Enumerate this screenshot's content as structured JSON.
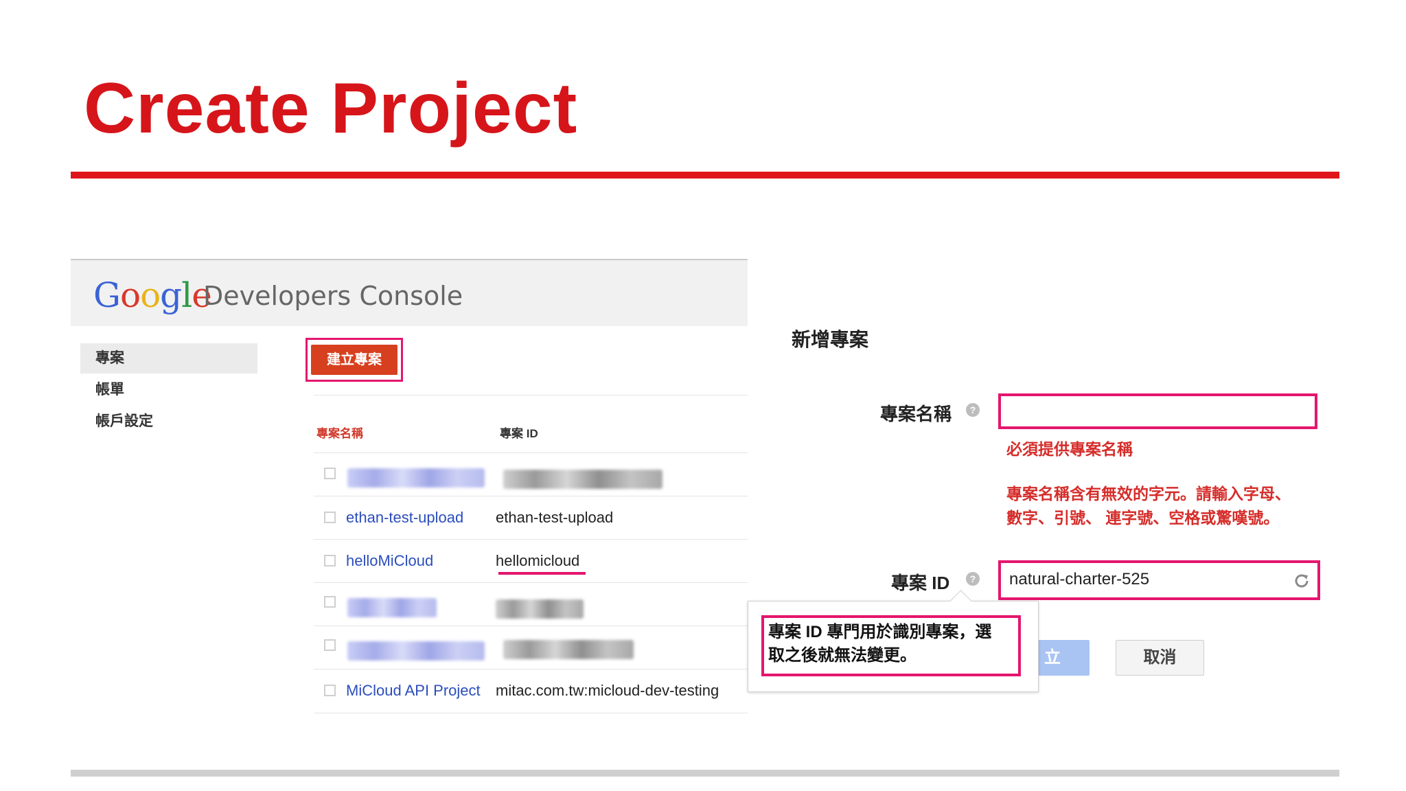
{
  "slide": {
    "title": "Create Project"
  },
  "console": {
    "logo_letters": [
      "G",
      "o",
      "o",
      "g",
      "l",
      "e"
    ],
    "title": "Developers Console",
    "sidebar": [
      {
        "label": "專案",
        "active": true
      },
      {
        "label": "帳單",
        "active": false
      },
      {
        "label": "帳戶設定",
        "active": false
      }
    ],
    "create_button": "建立專案",
    "table": {
      "headers": [
        "專案名稱",
        "專案 ID"
      ],
      "rows": [
        {
          "name": "",
          "id": "",
          "blurred": true
        },
        {
          "name": "ethan-test-upload",
          "id": "ethan-test-upload",
          "blurred": false
        },
        {
          "name": "helloMiCloud",
          "id": "hellomicloud",
          "blurred": false
        },
        {
          "name": "",
          "id": "",
          "blurred": true
        },
        {
          "name": "",
          "id": "",
          "blurred": true
        },
        {
          "name": "MiCloud API Project",
          "id": "mitac.com.tw:micloud-dev-testing",
          "blurred": false
        }
      ]
    }
  },
  "form": {
    "title": "新增專案",
    "name_label": "專案名稱",
    "name_value": "",
    "error_required": "必須提供專案名稱",
    "error_invalid_line1": "專案名稱含有無效的字元。請輸入字母、",
    "error_invalid_line2": "數字、引號、 連字號、空格或驚嘆號。",
    "id_label": "專案 ID",
    "id_value": "natural-charter-525",
    "help_icon": "?",
    "submit_partial": "立",
    "cancel_button": "取消"
  },
  "tooltip": {
    "line1": "專案 ID 專門用於識別專案，選",
    "line2": "取之後就無法變更。"
  },
  "colors": {
    "title_red": "#d6151a",
    "highlight_pink": "#e4166e",
    "error_red": "#d52d2a",
    "link_blue": "#2b4dbd",
    "create_button_orange": "#d7401f",
    "submit_button_blue": "#a9c3f3"
  }
}
